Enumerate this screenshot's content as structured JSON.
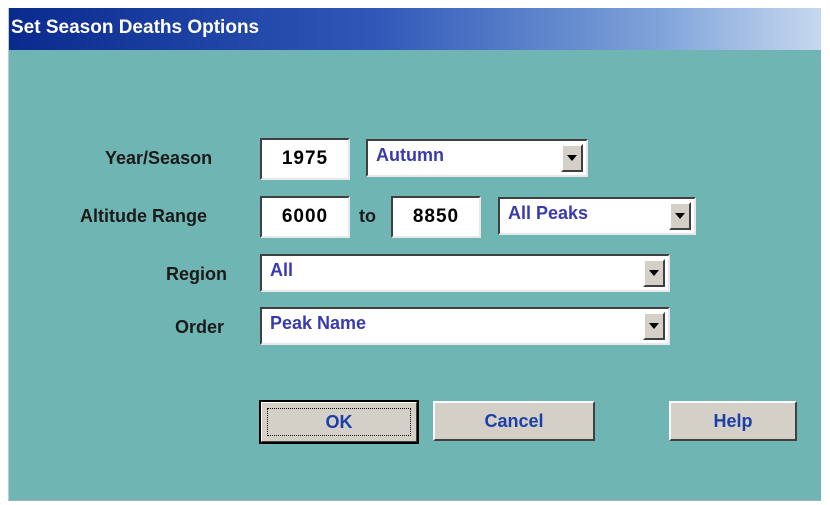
{
  "window": {
    "title": "Set Season Deaths Options"
  },
  "year_season": {
    "label": "Year/Season",
    "year": "1975",
    "season": "Autumn"
  },
  "altitude_range": {
    "label": "Altitude Range",
    "from": "6000",
    "to_label": "to",
    "to": "8850",
    "peaks": "All Peaks"
  },
  "region": {
    "label": "Region",
    "value": "All"
  },
  "order": {
    "label": "Order",
    "value": "Peak Name"
  },
  "buttons": {
    "ok": "OK",
    "cancel": "Cancel",
    "help": "Help"
  },
  "icons": {
    "dropdown": "chevron-down-icon"
  },
  "colors": {
    "dialog_bg": "#6fb5b3",
    "title_start": "#0a2a8e",
    "title_end": "#c6d8ef",
    "value_text": "#3a3ab0",
    "button_text": "#1a3fa8"
  }
}
